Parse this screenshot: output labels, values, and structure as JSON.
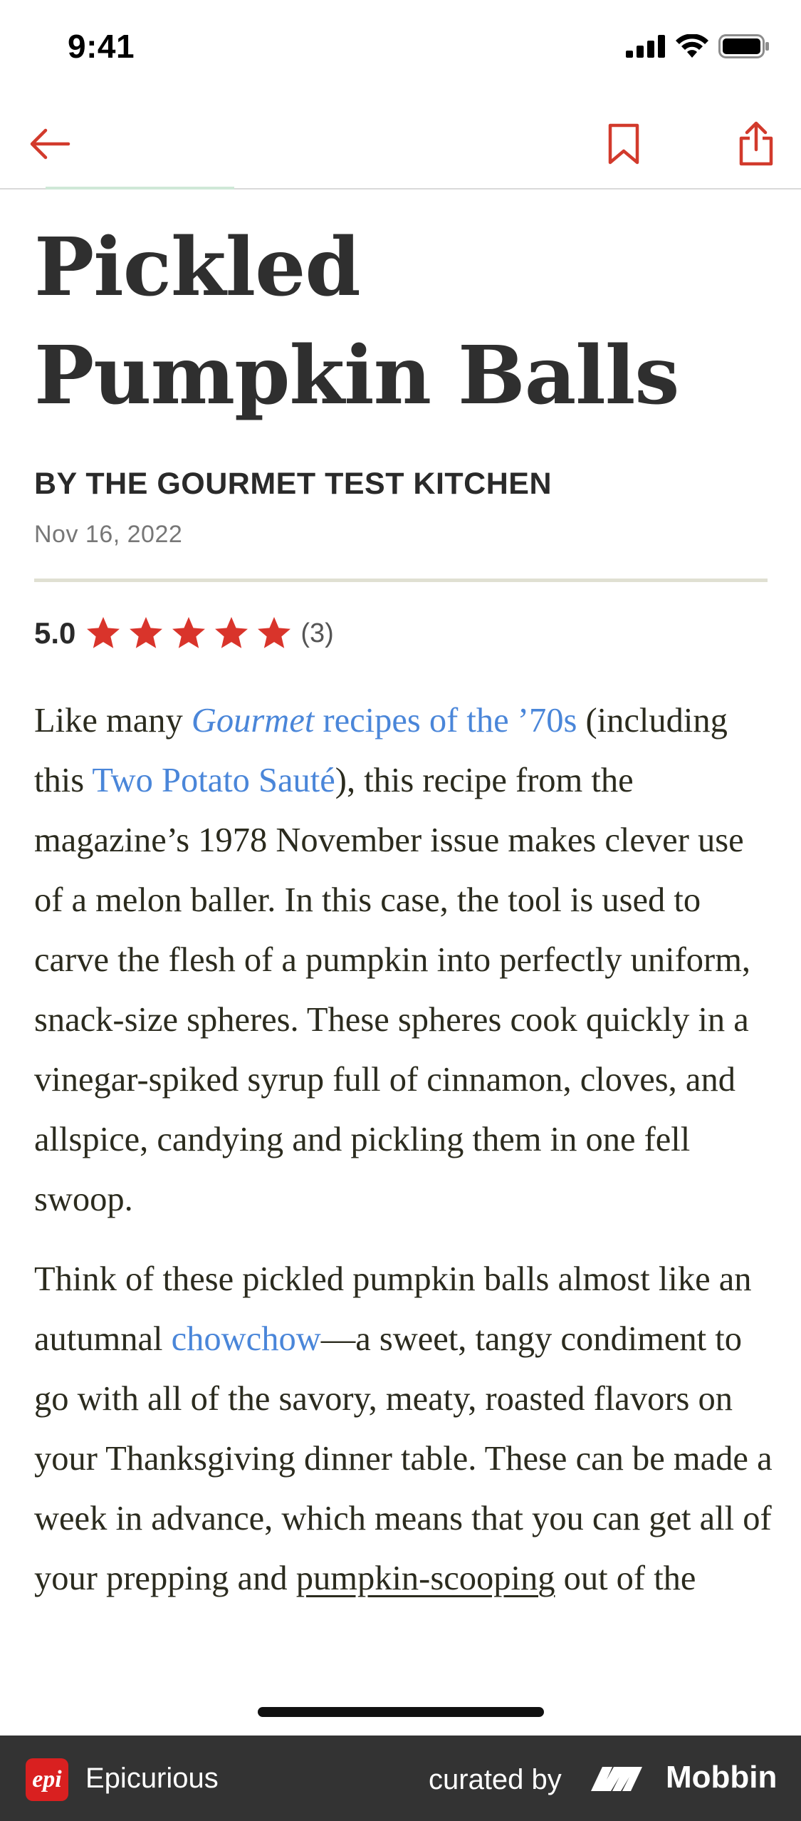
{
  "status_bar": {
    "time": "9:41"
  },
  "nav": {
    "back_icon": "arrow-left-icon",
    "bookmark_icon": "bookmark-icon",
    "share_icon": "share-icon",
    "accent_color": "#d23a2c"
  },
  "article": {
    "title": "Pickled Pumpkin Balls",
    "byline": "BY THE GOURMET TEST KITCHEN",
    "date": "Nov 16, 2022",
    "rating": {
      "value": "5.0",
      "stars": 5,
      "count": "(3)"
    },
    "p1": {
      "t1": "Like many ",
      "link1_em": "Gourmet",
      "link1_rest": " recipes of the ’70s",
      "t2": " (including this ",
      "link2": "Two Potato Sauté",
      "t3": "), this recipe from the magazine’s 1978 November issue makes clever use of a melon baller. In this case, the tool is used to carve the flesh of a pumpkin into perfectly uniform, snack-size spheres. These spheres cook quickly in a vinegar-spiked syrup full of cinnamon, cloves, and allspice, candying and pickling them in one fell swoop."
    },
    "p2": {
      "t1": "Think of these pickled pumpkin balls almost like an autumnal ",
      "link": "chowchow",
      "t2": "—a sweet, tangy condiment to go with all of the savory, meaty, roasted flavors on your Thanksgiving dinner table. These can be made a week in advance, which means that you can get all of your prepping and ",
      "underlined": "pumpkin-scooping",
      "t3": " out of the"
    }
  },
  "footer": {
    "app_badge": "epi",
    "app_name": "Epicurious",
    "curated_by": "curated by",
    "brand": "Mobbin"
  },
  "colors": {
    "star": "#d9342b",
    "link": "#4a86d9",
    "footer_bg": "#333333"
  }
}
